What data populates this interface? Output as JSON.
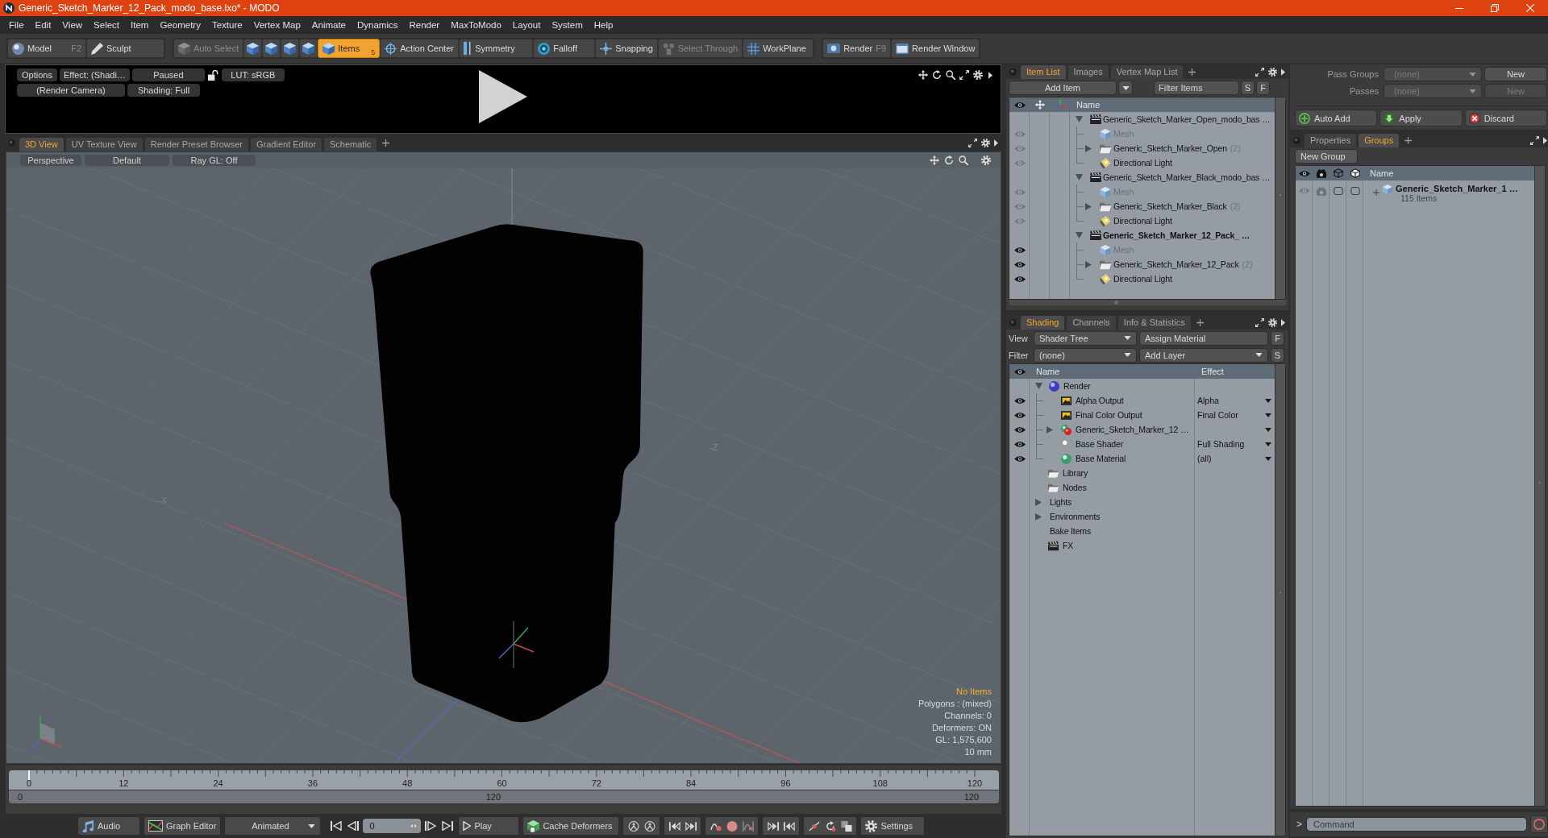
{
  "window": {
    "title": "Generic_Sketch_Marker_12_Pack_modo_base.lxo* - MODO"
  },
  "menu": [
    "File",
    "Edit",
    "View",
    "Select",
    "Item",
    "Geometry",
    "Texture",
    "Vertex Map",
    "Animate",
    "Dynamics",
    "Render",
    "MaxToModo",
    "Layout",
    "System",
    "Help"
  ],
  "toolbar": [
    {
      "buttons": [
        {
          "kind": "model",
          "label": "Model",
          "shortcut": "F2",
          "selected": false,
          "disabled": false
        },
        {
          "kind": "sculpt",
          "label": "Sculpt",
          "selected": false,
          "disabled": false
        }
      ]
    },
    {
      "buttons": [
        {
          "kind": "auto_select",
          "label": "Auto Select",
          "selected": false,
          "disabled": true
        },
        {
          "kind": "vertices",
          "selected": false,
          "disabled": false
        },
        {
          "kind": "edges",
          "selected": false,
          "disabled": false
        },
        {
          "kind": "polygons",
          "selected": false,
          "disabled": false
        },
        {
          "kind": "materials",
          "selected": false,
          "disabled": false
        },
        {
          "kind": "items",
          "label": "Items",
          "shortcut": "5",
          "selected": true,
          "disabled": false
        },
        {
          "kind": "action_center",
          "label": "Action Center",
          "selected": false,
          "disabled": false
        },
        {
          "kind": "symmetry",
          "label": "Symmetry",
          "selected": false,
          "disabled": false
        },
        {
          "kind": "falloff",
          "label": "Falloff",
          "selected": false,
          "disabled": false
        },
        {
          "kind": "snapping",
          "label": "Snapping",
          "selected": false,
          "disabled": false
        },
        {
          "kind": "select_through",
          "label": "Select Through",
          "selected": false,
          "disabled": true
        },
        {
          "kind": "workplane",
          "label": "WorkPlane",
          "selected": false,
          "disabled": false
        }
      ]
    },
    {
      "buttons": [
        {
          "kind": "render",
          "label": "Render",
          "shortcut": "F9",
          "selected": false,
          "disabled": false
        },
        {
          "kind": "render_window",
          "label": "Render Window",
          "selected": false,
          "disabled": false
        }
      ]
    }
  ],
  "render_preview": {
    "rows": [
      {
        "controls": [
          {
            "kind": "button",
            "label": "Options"
          },
          {
            "kind": "button",
            "label": "Effect: (Shadi…"
          },
          {
            "kind": "button",
            "label": "Paused"
          },
          {
            "kind": "lock"
          },
          {
            "kind": "button",
            "label": "LUT: sRGB"
          }
        ]
      },
      {
        "controls": [
          {
            "kind": "button",
            "label": "(Render Camera)"
          },
          {
            "kind": "button",
            "label": "Shading: Full"
          }
        ]
      }
    ]
  },
  "viewport_tabs": [
    {
      "label": "3D View",
      "selected": true
    },
    {
      "label": "UV Texture View",
      "selected": false
    },
    {
      "label": "Render Preset Browser",
      "selected": false
    },
    {
      "label": "Gradient Editor",
      "selected": false
    },
    {
      "label": "Schematic",
      "selected": false
    }
  ],
  "viewport": {
    "options": [
      "Perspective",
      "Default",
      "Ray GL: Off"
    ],
    "axis_labels": [
      "-X",
      "-Z"
    ],
    "stats": [
      {
        "kind": "selection",
        "text": "No Items"
      },
      {
        "kind": "info",
        "text": "Polygons : (mixed)"
      },
      {
        "kind": "info",
        "text": "Channels: 0"
      },
      {
        "kind": "info",
        "text": "Deformers: ON"
      },
      {
        "kind": "info",
        "text": "GL: 1,575,600"
      },
      {
        "kind": "info",
        "text": "10 mm"
      }
    ]
  },
  "timeline": {
    "ticks": [
      "0",
      "12",
      "24",
      "36",
      "48",
      "60",
      "72",
      "84",
      "96",
      "108",
      "120"
    ],
    "range": [
      "0",
      "120",
      "120"
    ]
  },
  "transport": {
    "audio": "Audio",
    "graph_editor": "Graph Editor",
    "mode": "Animated",
    "frame": "0",
    "play": "Play",
    "cache": "Cache Deformers",
    "settings": "Settings"
  },
  "item_list": {
    "tabs": [
      {
        "label": "Item List",
        "selected": true
      },
      {
        "label": "Images",
        "selected": false
      },
      {
        "label": "Vertex Map List",
        "selected": false
      }
    ],
    "add_item": "Add Item",
    "filter": {
      "placeholder": "Filter Items"
    },
    "buttons": [
      "S",
      "F"
    ],
    "column": "Name",
    "scenes": [
      {
        "name": "Generic_Sketch_Marker_Open_modo_bas …",
        "current": false,
        "expanded": true,
        "children": [
          {
            "kind": "mesh",
            "name": "Mesh"
          },
          {
            "kind": "group",
            "name": "Generic_Sketch_Marker_Open",
            "count": "(2)",
            "expanded": false
          },
          {
            "kind": "light",
            "name": "Directional Light"
          }
        ]
      },
      {
        "name": "Generic_Sketch_Marker_Black_modo_bas …",
        "current": false,
        "expanded": true,
        "children": [
          {
            "kind": "mesh",
            "name": "Mesh"
          },
          {
            "kind": "group",
            "name": "Generic_Sketch_Marker_Black",
            "count": "(2)",
            "expanded": false
          },
          {
            "kind": "light",
            "name": "Directional Light"
          }
        ]
      },
      {
        "name": "Generic_Sketch_Marker_12_Pack_ …",
        "current": true,
        "expanded": true,
        "children": [
          {
            "kind": "mesh",
            "name": "Mesh"
          },
          {
            "kind": "group",
            "name": "Generic_Sketch_Marker_12_Pack",
            "count": "(2)",
            "expanded": false
          },
          {
            "kind": "light",
            "name": "Directional Light"
          }
        ]
      }
    ]
  },
  "shading": {
    "tabs": [
      {
        "label": "Shading",
        "selected": true
      },
      {
        "label": "Channels",
        "selected": false
      },
      {
        "label": "Info & Statistics",
        "selected": false
      }
    ],
    "view": {
      "label": "View",
      "value": "Shader Tree"
    },
    "assign": "Assign Material",
    "filter": {
      "label": "Filter",
      "value": "(none)"
    },
    "add_layer": "Add Layer",
    "buttons": [
      "F",
      "S"
    ],
    "columns": [
      "Name",
      "Effect"
    ],
    "tree": [
      {
        "kind": "render",
        "name": "Render",
        "expanded": true,
        "children": [
          {
            "kind": "output",
            "name": "Alpha Output",
            "effect": "Alpha",
            "eye": true
          },
          {
            "kind": "output",
            "name": "Final Color Output",
            "effect": "Final Color",
            "eye": true
          },
          {
            "kind": "material_group",
            "name": "Generic_Sketch_Marker_12 …",
            "eye": true,
            "expanded": false
          },
          {
            "kind": "shader",
            "name": "Base Shader",
            "effect": "Full Shading",
            "eye": true
          },
          {
            "kind": "material",
            "name": "Base Material",
            "effect": "(all)",
            "eye": true
          }
        ]
      },
      {
        "kind": "folder",
        "name": "Library"
      },
      {
        "kind": "folder",
        "name": "Nodes"
      },
      {
        "kind": "category",
        "name": "Lights",
        "expanded": false
      },
      {
        "kind": "category",
        "name": "Environments",
        "expanded": false
      },
      {
        "kind": "category",
        "name": "Bake Items"
      },
      {
        "kind": "fx",
        "name": "FX"
      }
    ]
  },
  "passes": [
    {
      "label": "Pass Groups",
      "value": "(none)",
      "button": "New",
      "disabled": false
    },
    {
      "label": "Passes",
      "value": "(none)",
      "button": "New",
      "disabled": true
    }
  ],
  "actions": [
    {
      "kind": "auto_add",
      "label": "Auto Add"
    },
    {
      "kind": "apply",
      "label": "Apply"
    },
    {
      "kind": "discard",
      "label": "Discard"
    }
  ],
  "groups_panel": {
    "tabs": [
      {
        "label": "Properties",
        "selected": false
      },
      {
        "label": "Groups",
        "selected": true
      }
    ],
    "new_group": "New Group",
    "column": "Name",
    "groups": [
      {
        "name": "Generic_Sketch_Marker_1 …",
        "count": "115 Items",
        "expanded": false
      }
    ]
  },
  "command": {
    "prompt": ">",
    "placeholder": "Command"
  }
}
